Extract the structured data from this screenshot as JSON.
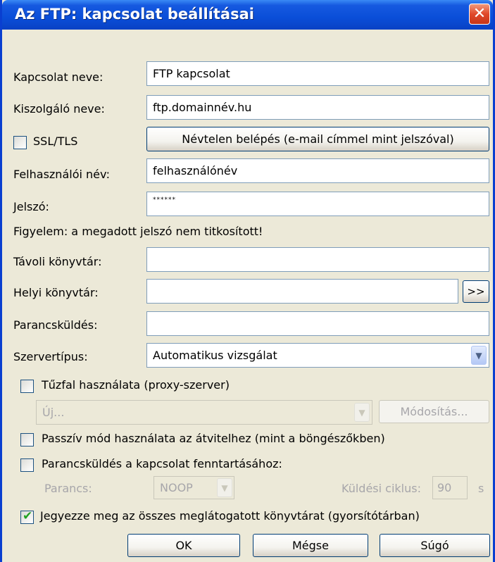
{
  "window": {
    "title": "Az FTP: kapcsolat beállításai",
    "close_glyph": "✕"
  },
  "labels": {
    "connection_name": "Kapcsolat neve:",
    "server_name": "Kiszolgáló neve:",
    "ssl": "SSL/TLS",
    "username": "Felhasználói név:",
    "password": "Jelszó:",
    "warning": "Figyelem: a megadott jelszó nem titkosított!",
    "remote_dir": "Távoli könyvtár:",
    "local_dir": "Helyi könyvtár:",
    "command": "Parancsküldés:",
    "server_type": "Szervertípus:",
    "firewall": "Tűzfal használata (proxy-szerver)",
    "passive": "Passzív mód használata az átvitelhez (mint a böngészőkben)",
    "keepalive": "Parancsküldés a kapcsolat fenntartásához:",
    "keepalive_command": "Parancs:",
    "send_interval": "Küldési ciklus:",
    "seconds_unit": "s",
    "remember": "Jegyezze meg az összes meglátogatott könyvtárat (gyorsítótárban)"
  },
  "fields": {
    "connection_name": "FTP kapcsolat",
    "server_name": "ftp.domainnév.hu",
    "username": "felhasználónév",
    "password": "******",
    "remote_dir": "",
    "local_dir": "",
    "command": "",
    "server_type": "Automatikus vizsgálat",
    "proxy": "Új...",
    "keepalive_command": "NOOP",
    "send_interval": "90"
  },
  "buttons": {
    "anonymous": "Névtelen belépés (e-mail címmel mint jelszóval)",
    "browse": ">>",
    "modify": "Módosítás...",
    "ok": "OK",
    "cancel": "Mégse",
    "help": "Súgó"
  },
  "checkboxes": {
    "ssl": false,
    "firewall": false,
    "passive": false,
    "keepalive": false,
    "remember": true
  },
  "icons": {
    "dropdown": "chevron-down-icon",
    "check": "checkmark-icon"
  }
}
